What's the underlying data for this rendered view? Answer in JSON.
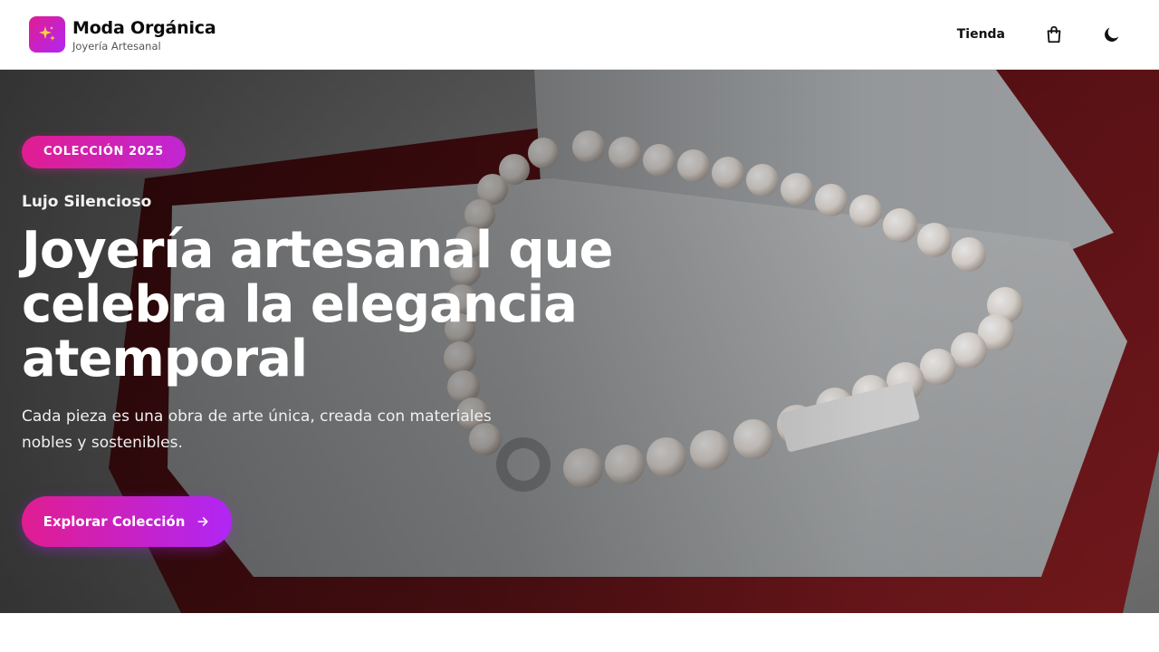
{
  "header": {
    "brand_title": "Moda Orgánica",
    "brand_subtitle": "Joyería Artesanal",
    "logo_icon": "sparkles-icon",
    "nav_link": "Tienda",
    "bag_icon": "shopping-bag-icon",
    "theme_icon": "moon-icon"
  },
  "hero": {
    "badge": "COLECCIÓN 2025",
    "eyebrow": "Lujo Silencioso",
    "headline": "Joyería artesanal que celebra la elegancia atemporal",
    "description": "Cada pieza es una obra de arte única, creada con materiales nobles y sostenibles.",
    "cta_label": "Explorar Colección",
    "cta_icon": "arrow-right-icon",
    "image": "pearl-necklace-in-red-box"
  },
  "colors": {
    "accent_start": "#e11d91",
    "accent_end": "#b026f5"
  }
}
